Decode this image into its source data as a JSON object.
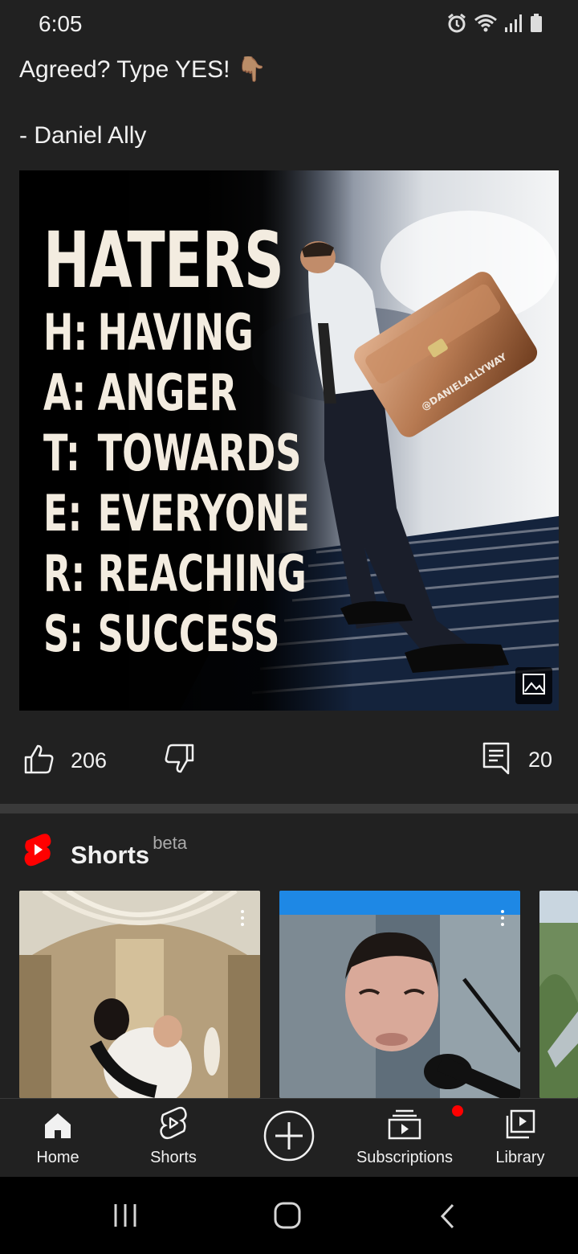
{
  "status_bar": {
    "time": "6:05",
    "icons": [
      "alarm-icon",
      "wifi-icon",
      "signal-icon",
      "battery-icon"
    ]
  },
  "post": {
    "text_line1": "Agreed? Type YES! 👇🏽",
    "text_line2": "- Daniel Ally",
    "image": {
      "title": "HATERS",
      "acronym": [
        {
          "letter": "H:",
          "word": "HAVING"
        },
        {
          "letter": "A:",
          "word": "ANGER"
        },
        {
          "letter": "T:",
          "word": "TOWARDS"
        },
        {
          "letter": "E:",
          "word": "EVERYONE"
        },
        {
          "letter": "R:",
          "word": "REACHING"
        },
        {
          "letter": "S:",
          "word": "SUCCESS"
        }
      ],
      "watermark": "@DANIELALLYWAY"
    },
    "likes": "206",
    "comments": "20"
  },
  "shorts": {
    "title": "Shorts",
    "badge": "beta"
  },
  "bottom_nav": {
    "items": [
      {
        "label": "Home",
        "icon": "home-icon"
      },
      {
        "label": "Shorts",
        "icon": "shorts-icon"
      },
      {
        "label": "",
        "icon": "create-icon"
      },
      {
        "label": "Subscriptions",
        "icon": "subscriptions-icon"
      },
      {
        "label": "Library",
        "icon": "library-icon"
      }
    ]
  },
  "colors": {
    "background": "#212121",
    "accent": "#ff0000",
    "text": "#f1f1f1"
  }
}
